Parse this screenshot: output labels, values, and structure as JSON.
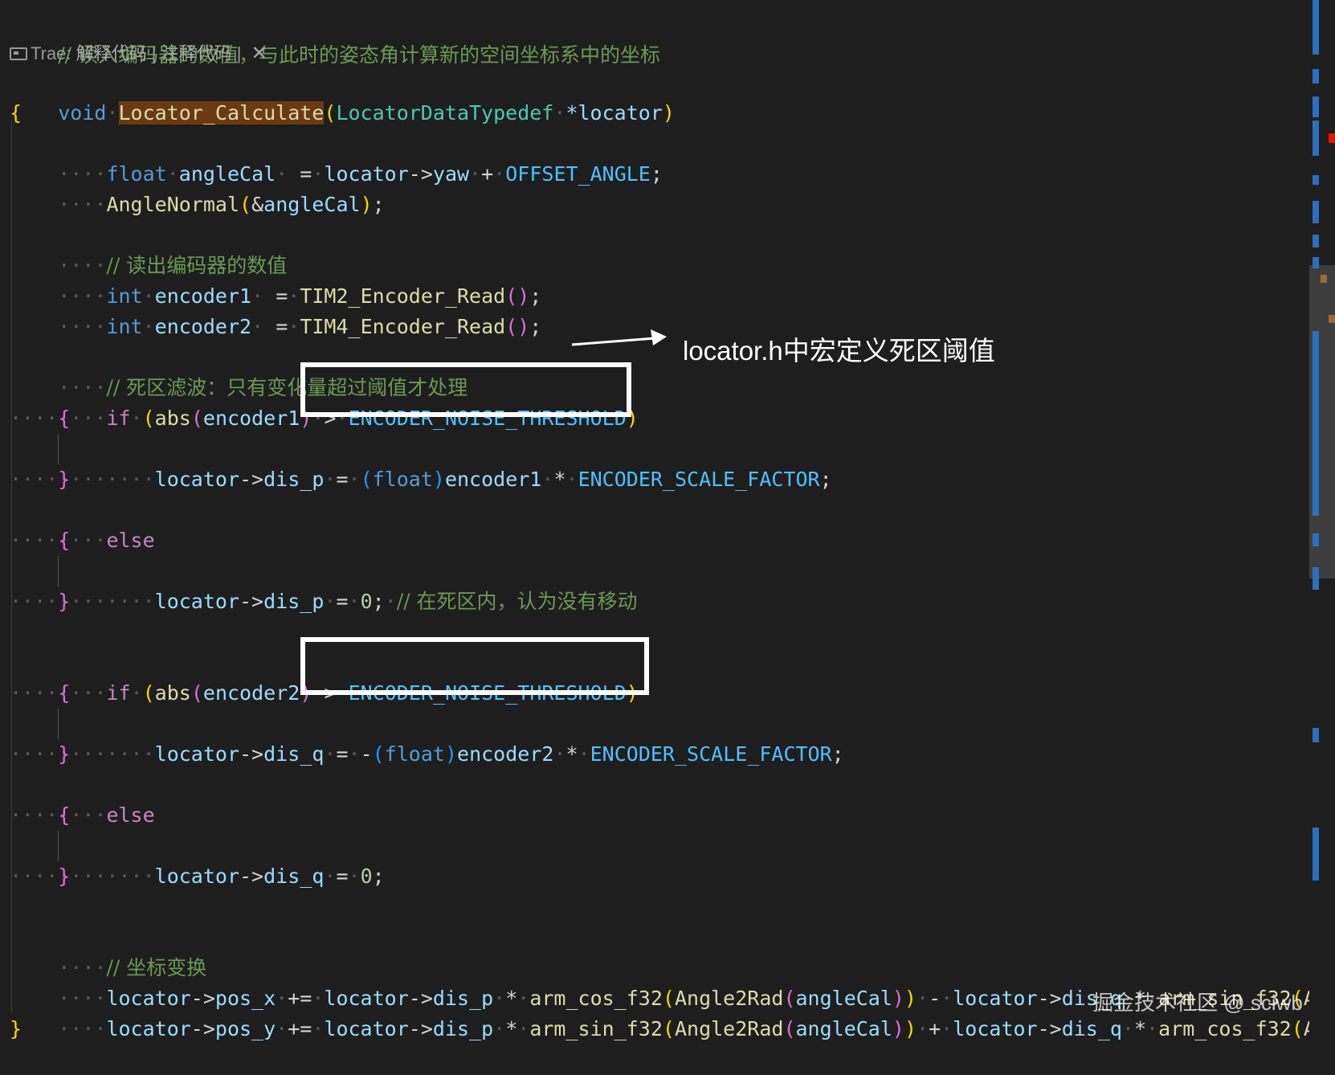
{
  "code": {
    "top_comment": "// 读入编码器的数值，与此时的姿态角计算新的空间坐标系中的坐标",
    "void_kw": "void",
    "func_name": "Locator_Calculate",
    "param_type": "LocatorDataTypedef",
    "param_name": "*locator",
    "float_kw": "float",
    "int_kw": "int",
    "if_kw": "if",
    "else_kw": "else",
    "angle_var": "angleCal",
    "locator": "locator",
    "yaw": "yaw",
    "offset_angle": "OFFSET_ANGLE",
    "angle_normal": "AngleNormal",
    "read_comment": "// 读出编码器的数值",
    "encoder1": "encoder1",
    "encoder2": "encoder2",
    "tim2_read": "TIM2_Encoder_Read",
    "tim4_read": "TIM4_Encoder_Read",
    "deadzone_comment": "// 死区滤波：只有变化量超过阈值才处理",
    "abs_fn": "abs",
    "threshold": "ENCODER_NOISE_THRESHOLD",
    "dis_p": "dis_p",
    "dis_q": "dis_q",
    "float_cast": "float",
    "scale_factor": "ENCODER_SCALE_FACTOR",
    "zero": "0",
    "deadzone_inner_comment": "// 在死区内，认为没有移动",
    "transform_comment": "// 坐标变换",
    "pos_x": "pos_x",
    "pos_y": "pos_y",
    "arm_cos": "arm_cos_f32",
    "arm_sin": "arm_sin_f32",
    "angle2rad": "Angle2Rad",
    "angl_trunc": "Angl"
  },
  "codelens": {
    "prefix": "Trae: ",
    "explain": "解释代码",
    "sep": " | ",
    "annotate": "注释代码",
    "close": "✕"
  },
  "annotation": {
    "text": "locator.h中宏定义死区阈值"
  },
  "watermark": "掘金技术社区 @ sciwb",
  "colors": {
    "background": "#1e1e1e",
    "keyword": "#569cd6",
    "function": "#dcdcaa",
    "type": "#4ec9b0",
    "variable": "#9cdcfe",
    "macro": "#4fc1ff",
    "comment": "#6a9955",
    "highlight": "#6b3a13"
  }
}
